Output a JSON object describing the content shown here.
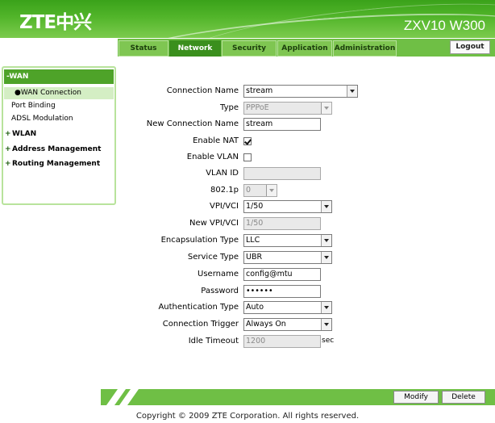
{
  "header": {
    "logo": "ZTE中兴",
    "model": "ZXV10 W300"
  },
  "nav": {
    "tabs": [
      {
        "label": "Status",
        "active": false
      },
      {
        "label": "Network",
        "active": true
      },
      {
        "label": "Security",
        "active": false
      },
      {
        "label": "Application",
        "active": false
      },
      {
        "label": "Administration",
        "active": false
      }
    ],
    "logout": "Logout"
  },
  "sidebar": {
    "header": "-WAN",
    "items": [
      {
        "label": "●WAN Connection",
        "active": true
      },
      {
        "label": "Port Binding",
        "active": false
      },
      {
        "label": "ADSL Modulation",
        "active": false
      }
    ],
    "groups": [
      {
        "label": "WLAN",
        "prefix": "+"
      },
      {
        "label": "Address Management",
        "prefix": "+"
      },
      {
        "label": "Routing Management",
        "prefix": "+"
      }
    ]
  },
  "form": {
    "connection_name": {
      "label": "Connection Name",
      "value": "stream"
    },
    "type": {
      "label": "Type",
      "value": "PPPoE"
    },
    "new_connection_name": {
      "label": "New Connection Name",
      "value": "stream"
    },
    "enable_nat": {
      "label": "Enable NAT",
      "checked": true
    },
    "enable_vlan": {
      "label": "Enable VLAN",
      "checked": false
    },
    "vlan_id": {
      "label": "VLAN ID",
      "value": ""
    },
    "p8021": {
      "label": "802.1p",
      "value": "0"
    },
    "vpi_vci": {
      "label": "VPI/VCI",
      "value": "1/50"
    },
    "new_vpi_vci": {
      "label": "New VPI/VCI",
      "value": "1/50"
    },
    "encapsulation": {
      "label": "Encapsulation Type",
      "value": "LLC"
    },
    "service_type": {
      "label": "Service Type",
      "value": "UBR"
    },
    "username": {
      "label": "Username",
      "value": "config@mtu"
    },
    "password": {
      "label": "Password",
      "value": "••••••"
    },
    "auth_type": {
      "label": "Authentication Type",
      "value": "Auto"
    },
    "conn_trigger": {
      "label": "Connection Trigger",
      "value": "Always On"
    },
    "idle_timeout": {
      "label": "Idle Timeout",
      "value": "1200",
      "unit": "sec"
    }
  },
  "footer": {
    "modify": "Modify",
    "delete": "Delete",
    "copyright": "Copyright © 2009 ZTE Corporation. All rights reserved."
  },
  "colors": {
    "brand_green": "#4ea329",
    "nav_active": "#3a8f1d",
    "nav_strip": "#6fbf45"
  }
}
